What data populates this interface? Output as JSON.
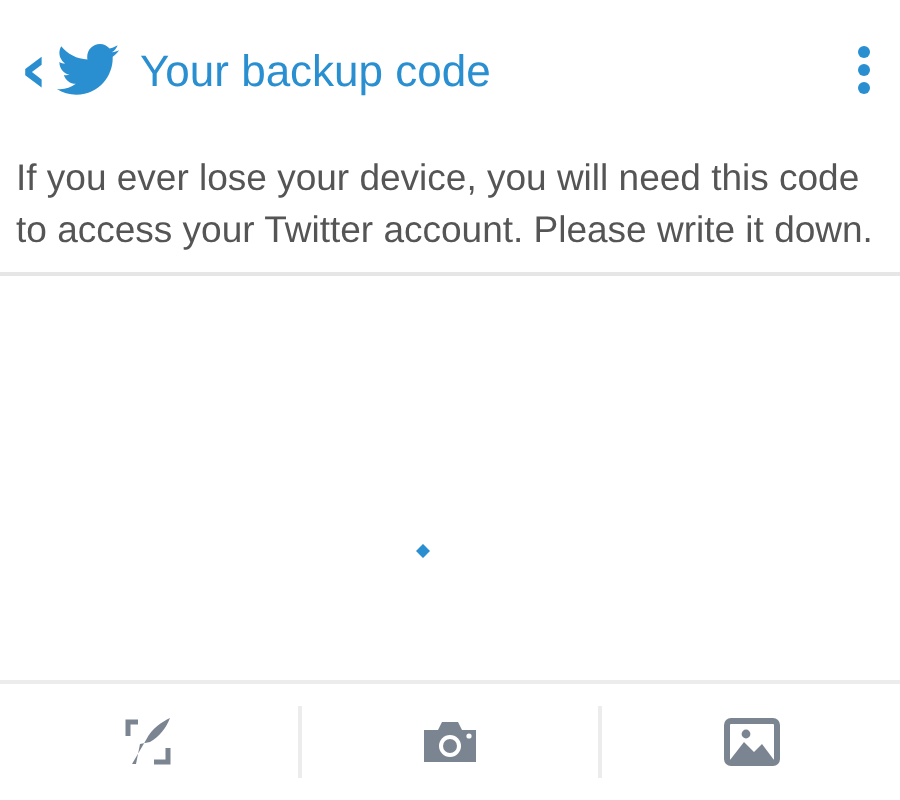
{
  "header": {
    "back": "‹",
    "title": "Your backup code"
  },
  "message": "If you ever lose your device, you will need this code to access your Twitter account. Please write it down.",
  "toolbar": [
    {
      "kind": "compose"
    },
    {
      "kind": "camera"
    },
    {
      "kind": "image"
    }
  ]
}
